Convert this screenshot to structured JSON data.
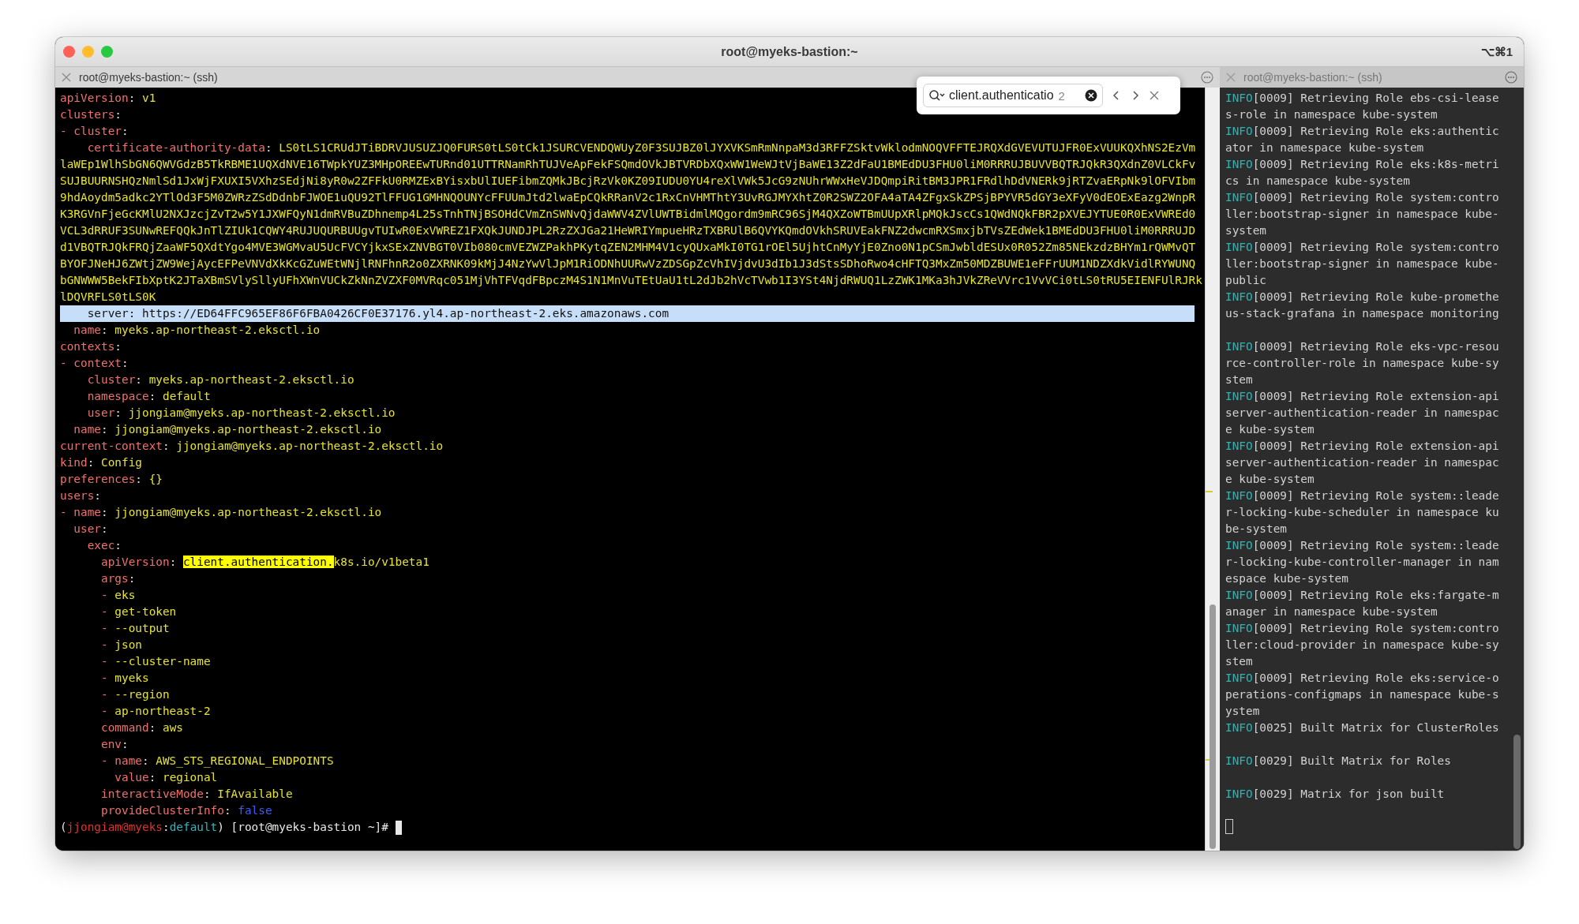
{
  "window": {
    "title": "root@myeks-bastion:~",
    "shortcut": "⌥⌘1"
  },
  "left_pane": {
    "tab_title": "root@myeks-bastion:~ (ssh)",
    "search": {
      "value": "client.authenticatio",
      "count": "2"
    },
    "lines": [
      {
        "highlighted": false,
        "segments": [
          {
            "kind": "key",
            "text": "apiVersion"
          },
          {
            "kind": "sep",
            "text": ": "
          },
          {
            "kind": "val",
            "text": "v1"
          }
        ]
      },
      {
        "highlighted": false,
        "segments": [
          {
            "kind": "key",
            "text": "clusters"
          },
          {
            "kind": "sep",
            "text": ":"
          }
        ]
      },
      {
        "highlighted": false,
        "segments": [
          {
            "kind": "key",
            "text": "- cluster"
          },
          {
            "kind": "sep",
            "text": ":"
          }
        ]
      },
      {
        "highlighted": false,
        "segments": [
          {
            "kind": "key",
            "text": "    certificate-authority-data"
          },
          {
            "kind": "sep",
            "text": ": "
          },
          {
            "kind": "val",
            "text": "LS0tLS1CRUdJTiBDRVJUSUZJQ0FURS0tLS0tCk1JSURCVENDQWUyZ0F3SUJBZ0lJYXVKSmRmNnpaM3d3RFFZSktvWklodmNOQVFFTEJRQXdGVEVUTUJFR0ExVUUKQXhNS2EzVm"
          }
        ]
      },
      {
        "highlighted": false,
        "segments": [
          {
            "kind": "val",
            "text": "laWEp1WlhSbGN6QWVGdzB5TkRBME1UQXdNVE16TWpkYUZ3MHpOREEwTURnd01UTTRNamRhTUJVeApFekFSQmdOVkJBTVRDbXQxWW1WeWJtVjBaWE13Z2dFaU1BMEdDU3FHU0liM0RRRUJBUVVBQTRJQkR3QXdnZ0VLCkFv"
          }
        ]
      },
      {
        "highlighted": false,
        "segments": [
          {
            "kind": "val",
            "text": "SUJBUURNSHQzNmlSd1JxWjFXUXI5VXhzSEdjNi8yR0w2ZFFkU0RMZExBYisxbUlIUEFibmZQMkJBcjRzVk0KZ09IUDU0YU4reXlVWk5JcG9zNUhrWWxHeVJDQmpiRitBM3JPR1FRdlhDdVNERk9jRTZvaERpNk9lOFVIbm"
          }
        ]
      },
      {
        "highlighted": false,
        "segments": [
          {
            "kind": "val",
            "text": "9hdAoydm5adkc2YTlOd3F5M0ZWRzZSdDdnbFJWOE1uQU92TlFFUG1GMHNQOUNYcFFUUmJtd2lwaEpCQkRRanV2c1RxCnVHMThtY3UvRGJMYXhtZ0R2SWZ2OFA4aTA4ZFgxSkZPSjBPYVR5dGY3eXFyV0dEOExEazg2WnpR"
          }
        ]
      },
      {
        "highlighted": false,
        "segments": [
          {
            "kind": "val",
            "text": "K3RGVnFjeGcKMlU2NXJzcjZvT2w5Y1JXWFQyN1dmRVBuZDhnemp4L25sTnhTNjBSOHdCVmZnSWNvQjdaWWV4ZVlUWTBidmlMQgordm9mRC96SjM4QXZoWTBmUUpXRlpMQkJscCs1QWdNQkFBR2pXVEJYTUE0R0ExVWREd0"
          }
        ]
      },
      {
        "highlighted": false,
        "segments": [
          {
            "kind": "val",
            "text": "VCL3dRRUF3SUNwREFQQkJnTlZIUk1CQWY4RUJUQURBUUgvTUIwR0ExVWREZ1FXQkJUNDJPL2RzZXJGa21HeWRIYmpueHRzTXBRUlB6QVYKQmdOVkhSRUVEakFNZ2dwcmRXSmxjbTVsZEdWek1BMEdDU3FHU0liM0RRRUJD"
          }
        ]
      },
      {
        "highlighted": false,
        "segments": [
          {
            "kind": "val",
            "text": "d1VBQTRJQkFRQjZaaWF5QXdtYgo4MVE3WGMvaU5UcFVCYjkxSExZNVBGT0VIb080cmVEZWZPakhPKytqZEN2MHM4V1cyQUxaMkI0TG1rOEl5UjhtCnMyYjE0Zno0N1pCSmJwbldESUx0R052Zm85NEkzdzBHYm1rQWMvQT"
          }
        ]
      },
      {
        "highlighted": false,
        "segments": [
          {
            "kind": "val",
            "text": "BYOFJNeHJ6ZWtjZW9WejAycEFPeVNVdXkKcGZuWEtWNjlRNFhnR2o0ZXRNK09kMjJ4NzYwVlJpM1RiODNhUURwVzZDSGpZcVhIVjdvU3dIb1J3dStsSDhoRwo4cHFTQ3MxZm50MDZBUWE1eFFrUUM1NDZXdkVidlRYWUNQ"
          }
        ]
      },
      {
        "highlighted": false,
        "segments": [
          {
            "kind": "val",
            "text": "bGNWWW5BekFIbXptK2JTaXBmSVlySllyUFhXWnVUCkZkNnZVZXF0MVRqc051MjVhTFVqdFBpczM4S1N1MnVuTEtUaU1tL2dJb2hVcTVwb1I3YSt4NjdRWUQ1LzZWK1MKa3hJVkZReVVrc1VvVCi0tLS0tRU5EIENFUlRJRk"
          }
        ]
      },
      {
        "highlighted": false,
        "segments": [
          {
            "kind": "val",
            "text": "lDQVRFLS0tLS0K"
          }
        ]
      },
      {
        "highlighted": true,
        "segments": [
          {
            "kind": "key",
            "text": "    server"
          },
          {
            "kind": "sep",
            "text": ": "
          },
          {
            "kind": "val",
            "text": "https://ED64FFC965EF86F6FBA0426CF0E37176.yl4.ap-northeast-2.eks.amazonaws.com"
          }
        ]
      },
      {
        "highlighted": false,
        "segments": [
          {
            "kind": "key",
            "text": "  name"
          },
          {
            "kind": "sep",
            "text": ": "
          },
          {
            "kind": "val",
            "text": "myeks.ap-northeast-2.eksctl.io"
          }
        ]
      },
      {
        "highlighted": false,
        "segments": [
          {
            "kind": "key",
            "text": "contexts"
          },
          {
            "kind": "sep",
            "text": ":"
          }
        ]
      },
      {
        "highlighted": false,
        "segments": [
          {
            "kind": "key",
            "text": "- context"
          },
          {
            "kind": "sep",
            "text": ":"
          }
        ]
      },
      {
        "highlighted": false,
        "segments": [
          {
            "kind": "key",
            "text": "    cluster"
          },
          {
            "kind": "sep",
            "text": ": "
          },
          {
            "kind": "val",
            "text": "myeks.ap-northeast-2.eksctl.io"
          }
        ]
      },
      {
        "highlighted": false,
        "segments": [
          {
            "kind": "key",
            "text": "    namespace"
          },
          {
            "kind": "sep",
            "text": ": "
          },
          {
            "kind": "val",
            "text": "default"
          }
        ]
      },
      {
        "highlighted": false,
        "segments": [
          {
            "kind": "key",
            "text": "    user"
          },
          {
            "kind": "sep",
            "text": ": "
          },
          {
            "kind": "val",
            "text": "jjongiam@myeks.ap-northeast-2.eksctl.io"
          }
        ]
      },
      {
        "highlighted": false,
        "segments": [
          {
            "kind": "key",
            "text": "  name"
          },
          {
            "kind": "sep",
            "text": ": "
          },
          {
            "kind": "val",
            "text": "jjongiam@myeks.ap-northeast-2.eksctl.io"
          }
        ]
      },
      {
        "highlighted": false,
        "segments": [
          {
            "kind": "key",
            "text": "current-context"
          },
          {
            "kind": "sep",
            "text": ": "
          },
          {
            "kind": "val",
            "text": "jjongiam@myeks.ap-northeast-2.eksctl.io"
          }
        ]
      },
      {
        "highlighted": false,
        "segments": [
          {
            "kind": "key",
            "text": "kind"
          },
          {
            "kind": "sep",
            "text": ": "
          },
          {
            "kind": "val",
            "text": "Config"
          }
        ]
      },
      {
        "highlighted": false,
        "segments": [
          {
            "kind": "key",
            "text": "preferences"
          },
          {
            "kind": "sep",
            "text": ": "
          },
          {
            "kind": "val",
            "text": "{}"
          }
        ]
      },
      {
        "highlighted": false,
        "segments": [
          {
            "kind": "key",
            "text": "users"
          },
          {
            "kind": "sep",
            "text": ":"
          }
        ]
      },
      {
        "highlighted": false,
        "segments": [
          {
            "kind": "key",
            "text": "- name"
          },
          {
            "kind": "sep",
            "text": ": "
          },
          {
            "kind": "val",
            "text": "jjongiam@myeks.ap-northeast-2.eksctl.io"
          }
        ]
      },
      {
        "highlighted": false,
        "segments": [
          {
            "kind": "key",
            "text": "  user"
          },
          {
            "kind": "sep",
            "text": ":"
          }
        ]
      },
      {
        "highlighted": false,
        "segments": [
          {
            "kind": "key",
            "text": "    exec"
          },
          {
            "kind": "sep",
            "text": ":"
          }
        ]
      },
      {
        "highlighted": false,
        "segments": [
          {
            "kind": "key",
            "text": "      apiVersion"
          },
          {
            "kind": "sep",
            "text": ": "
          },
          {
            "kind": "match",
            "text": "client.authentication."
          },
          {
            "kind": "val",
            "text": "k8s.io/v1beta1"
          }
        ]
      },
      {
        "highlighted": false,
        "segments": [
          {
            "kind": "key",
            "text": "      args"
          },
          {
            "kind": "sep",
            "text": ":"
          }
        ]
      },
      {
        "highlighted": false,
        "segments": [
          {
            "kind": "key",
            "text": "      - "
          },
          {
            "kind": "val",
            "text": "eks"
          }
        ]
      },
      {
        "highlighted": false,
        "segments": [
          {
            "kind": "key",
            "text": "      - "
          },
          {
            "kind": "val",
            "text": "get-token"
          }
        ]
      },
      {
        "highlighted": false,
        "segments": [
          {
            "kind": "key",
            "text": "      - "
          },
          {
            "kind": "val",
            "text": "--output"
          }
        ]
      },
      {
        "highlighted": false,
        "segments": [
          {
            "kind": "key",
            "text": "      - "
          },
          {
            "kind": "val",
            "text": "json"
          }
        ]
      },
      {
        "highlighted": false,
        "segments": [
          {
            "kind": "key",
            "text": "      - "
          },
          {
            "kind": "val",
            "text": "--cluster-name"
          }
        ]
      },
      {
        "highlighted": false,
        "segments": [
          {
            "kind": "key",
            "text": "      - "
          },
          {
            "kind": "val",
            "text": "myeks"
          }
        ]
      },
      {
        "highlighted": false,
        "segments": [
          {
            "kind": "key",
            "text": "      - "
          },
          {
            "kind": "val",
            "text": "--region"
          }
        ]
      },
      {
        "highlighted": false,
        "segments": [
          {
            "kind": "key",
            "text": "      - "
          },
          {
            "kind": "val",
            "text": "ap-northeast-2"
          }
        ]
      },
      {
        "highlighted": false,
        "segments": [
          {
            "kind": "key",
            "text": "      command"
          },
          {
            "kind": "sep",
            "text": ": "
          },
          {
            "kind": "val",
            "text": "aws"
          }
        ]
      },
      {
        "highlighted": false,
        "segments": [
          {
            "kind": "key",
            "text": "      env"
          },
          {
            "kind": "sep",
            "text": ":"
          }
        ]
      },
      {
        "highlighted": false,
        "segments": [
          {
            "kind": "key",
            "text": "      - name"
          },
          {
            "kind": "sep",
            "text": ": "
          },
          {
            "kind": "val",
            "text": "AWS_STS_REGIONAL_ENDPOINTS"
          }
        ]
      },
      {
        "highlighted": false,
        "segments": [
          {
            "kind": "key",
            "text": "        value"
          },
          {
            "kind": "sep",
            "text": ": "
          },
          {
            "kind": "val",
            "text": "regional"
          }
        ]
      },
      {
        "highlighted": false,
        "segments": [
          {
            "kind": "key",
            "text": "      interactiveMode"
          },
          {
            "kind": "sep",
            "text": ": "
          },
          {
            "kind": "val",
            "text": "IfAvailable"
          }
        ]
      },
      {
        "highlighted": false,
        "segments": [
          {
            "kind": "key",
            "text": "      provideClusterInfo"
          },
          {
            "kind": "sep",
            "text": ": "
          },
          {
            "kind": "bool",
            "text": "false"
          }
        ]
      }
    ],
    "prompt": [
      {
        "kind": "plain",
        "text": "("
      },
      {
        "kind": "user",
        "text": "jjongiam@myeks"
      },
      {
        "kind": "plain",
        "text": ":"
      },
      {
        "kind": "ns",
        "text": "default"
      },
      {
        "kind": "plain",
        "text": ") [root@myeks-bastion ~]# "
      }
    ]
  },
  "right_pane": {
    "tab_title": "root@myeks-bastion:~ (ssh)",
    "blocks": [
      [
        {
          "level": "INFO",
          "text": "[0009] Retrieving Role ebs-csi-leases-role in namespace kube-system"
        },
        {
          "level": "INFO",
          "text": "[0009] Retrieving Role eks:authenticator in namespace kube-system"
        },
        {
          "level": "INFO",
          "text": "[0009] Retrieving Role eks:k8s-metrics in namespace kube-system"
        },
        {
          "level": "INFO",
          "text": "[0009] Retrieving Role system:controller:bootstrap-signer in namespace kube-system"
        },
        {
          "level": "INFO",
          "text": "[0009] Retrieving Role system:controller:bootstrap-signer in namespace kube-public"
        },
        {
          "level": "INFO",
          "text": "[0009] Retrieving Role kube-prometheus-stack-grafana in namespace monitoring"
        }
      ],
      [
        {
          "level": "INFO",
          "text": "[0009] Retrieving Role eks-vpc-resource-controller-role in namespace kube-system"
        },
        {
          "level": "INFO",
          "text": "[0009] Retrieving Role extension-apiserver-authentication-reader in namespace kube-system"
        },
        {
          "level": "INFO",
          "text": "[0009] Retrieving Role extension-apiserver-authentication-reader in namespace kube-system"
        },
        {
          "level": "INFO",
          "text": "[0009] Retrieving Role system::leader-locking-kube-scheduler in namespace kube-system"
        },
        {
          "level": "INFO",
          "text": "[0009] Retrieving Role system::leader-locking-kube-controller-manager in namespace kube-system"
        },
        {
          "level": "INFO",
          "text": "[0009] Retrieving Role eks:fargate-manager in namespace kube-system"
        },
        {
          "level": "INFO",
          "text": "[0009] Retrieving Role system:controller:cloud-provider in namespace kube-system"
        },
        {
          "level": "INFO",
          "text": "[0009] Retrieving Role eks:service-operations-configmaps in namespace kube-system"
        },
        {
          "level": "INFO",
          "text": "[0025] Built Matrix for ClusterRoles"
        }
      ],
      [
        {
          "level": "INFO",
          "text": "[0029] Built Matrix for Roles"
        }
      ],
      [
        {
          "level": "INFO",
          "text": "[0029] Matrix for json built"
        }
      ]
    ]
  }
}
